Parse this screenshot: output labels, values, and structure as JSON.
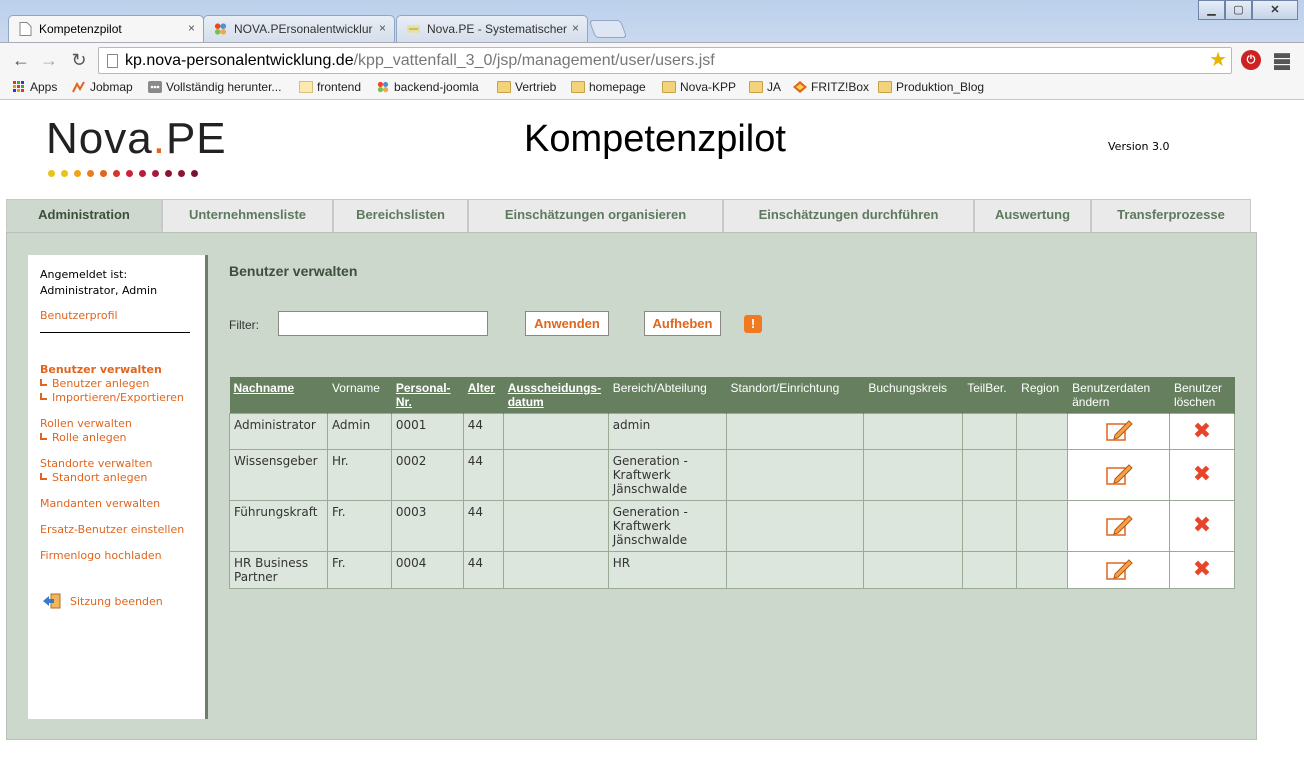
{
  "browser": {
    "tabs": [
      {
        "label": "Kompetenzpilot",
        "active": true
      },
      {
        "label": "NOVA.PErsonalentwicklur",
        "active": false
      },
      {
        "label": "Nova.PE - Systematischer",
        "active": false
      }
    ],
    "tab_close": "×",
    "url_host": "kp.nova-personalentwicklung.de",
    "url_path": "/kpp_vattenfall_3_0/jsp/management/user/users.jsf",
    "bookmarks": [
      {
        "label": "Apps",
        "icon": "apps-grid-icon"
      },
      {
        "label": "Jobmap",
        "icon": "jobmap-icon"
      },
      {
        "label": "Vollständig herunter...",
        "icon": "download-icon"
      },
      {
        "label": "frontend",
        "icon": "folder-icon"
      },
      {
        "label": "backend-joomla",
        "icon": "joomla-icon"
      },
      {
        "label": "Vertrieb",
        "icon": "folder-icon"
      },
      {
        "label": "homepage",
        "icon": "folder-icon"
      },
      {
        "label": "Nova-KPP",
        "icon": "folder-icon"
      },
      {
        "label": "JA",
        "icon": "folder-icon"
      },
      {
        "label": "FRITZ!Box",
        "icon": "fritzbox-icon"
      },
      {
        "label": "Produktion_Blog",
        "icon": "folder-icon"
      }
    ]
  },
  "header": {
    "logo_text_1": "Nova",
    "logo_dot": ".",
    "logo_text_2": "PE",
    "app_title": "Kompetenzpilot",
    "version": "Version 3.0"
  },
  "nav": {
    "tabs": [
      {
        "label": "Administration",
        "active": true
      },
      {
        "label": "Unternehmensliste",
        "active": false
      },
      {
        "label": "Bereichslisten",
        "active": false
      },
      {
        "label": "Einschätzungen organisieren",
        "active": false
      },
      {
        "label": "Einschätzungen durchführen",
        "active": false
      },
      {
        "label": "Auswertung",
        "active": false
      },
      {
        "label": "Transferprozesse",
        "active": false
      }
    ]
  },
  "sidebar": {
    "login_label": "Angemeldet ist:",
    "login_user": "Administrator, Admin",
    "profile_link": "Benutzerprofil",
    "items": {
      "users_manage": "Benutzer verwalten",
      "users_create": "Benutzer anlegen",
      "import_export": "Importieren/Exportieren",
      "roles_manage": "Rollen verwalten",
      "role_create": "Rolle anlegen",
      "sites_manage": "Standorte verwalten",
      "site_create": "Standort anlegen",
      "tenants_manage": "Mandanten verwalten",
      "substitute_users": "Ersatz-Benutzer einstellen",
      "company_logo": "Firmenlogo hochladen",
      "logout": "Sitzung beenden"
    }
  },
  "main": {
    "heading": "Benutzer verwalten",
    "filter_label": "Filter:",
    "filter_value": "",
    "apply_button": "Anwenden",
    "reset_button": "Aufheben",
    "warn_glyph": "!"
  },
  "table": {
    "headers": [
      {
        "label": "Nachname",
        "sortable": true
      },
      {
        "label": "Vorname",
        "sortable": false
      },
      {
        "label": "Personal-Nr.",
        "sortable": true
      },
      {
        "label": "Alter",
        "sortable": true
      },
      {
        "label": "Ausscheidungs-datum",
        "sortable": true
      },
      {
        "label": "Bereich/Abteilung",
        "sortable": false
      },
      {
        "label": "Standort/Einrichtung",
        "sortable": false
      },
      {
        "label": "Buchungskreis",
        "sortable": false
      },
      {
        "label": "TeilBer.",
        "sortable": false
      },
      {
        "label": "Region",
        "sortable": false
      },
      {
        "label": "Benutzerdaten ändern",
        "sortable": false
      },
      {
        "label": "Benutzer löschen",
        "sortable": false
      }
    ],
    "rows": [
      {
        "nachname": "Administrator",
        "vorname": "Admin",
        "personal_nr": "0001",
        "alter": "44",
        "ausscheidungsdatum": "",
        "bereich": "admin",
        "standort": "",
        "buchungskreis": "",
        "teilber": "",
        "region": ""
      },
      {
        "nachname": "Wissensgeber",
        "vorname": "Hr.",
        "personal_nr": "0002",
        "alter": "44",
        "ausscheidungsdatum": "",
        "bereich": "Generation - Kraftwerk Jänschwalde",
        "standort": "",
        "buchungskreis": "",
        "teilber": "",
        "region": ""
      },
      {
        "nachname": "Führungskraft",
        "vorname": "Fr.",
        "personal_nr": "0003",
        "alter": "44",
        "ausscheidungsdatum": "",
        "bereich": "Generation - Kraftwerk Jänschwalde",
        "standort": "",
        "buchungskreis": "",
        "teilber": "",
        "region": ""
      },
      {
        "nachname": "HR Business Partner",
        "vorname": "Fr.",
        "personal_nr": "0004",
        "alter": "44",
        "ausscheidungsdatum": "",
        "bereich": "HR",
        "standort": "",
        "buchungskreis": "",
        "teilber": "",
        "region": ""
      }
    ],
    "delete_glyph": "✖"
  },
  "colors": {
    "accent_orange": "#e0651e",
    "header_green": "#66805f",
    "content_bg": "#cdd8cd",
    "logo_dots": [
      "#e8c41a",
      "#e8c41a",
      "#f0a21a",
      "#ec7b1e",
      "#e0651e",
      "#d9352a",
      "#c9253a",
      "#b81d3e",
      "#a51a3c",
      "#8a1634"
    ]
  }
}
